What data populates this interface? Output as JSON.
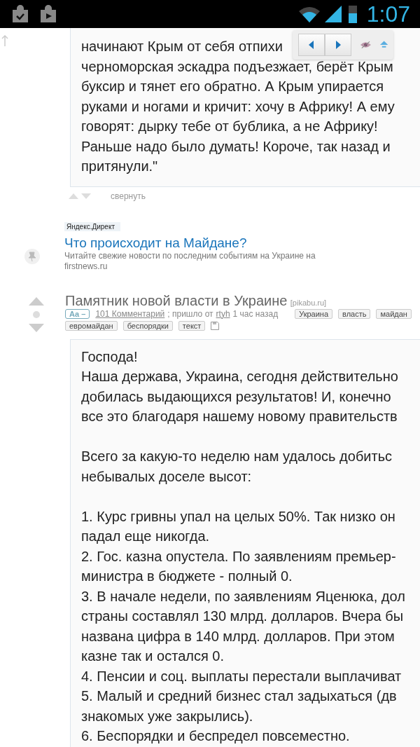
{
  "status_bar": {
    "time": "1:07"
  },
  "comment": {
    "lines": [
      "начинают Крым от себя отпихи",
      "черноморская эскадра подъезжает, берёт Крым",
      "буксир и тянет его обратно. А Крым упирается",
      "руками и ногами и кричит: хочу в Африку! А ему",
      "говорят: дырку тебе от бублика, а не Африку!",
      "Раньше надо было думать! Короче, так назад и",
      "притянули.\""
    ],
    "collapse_label": "свернуть"
  },
  "ad": {
    "label": "Яндекс.Директ",
    "title": "Что происходит на Майдане?",
    "description": "Читайте свежие новости по последним событиям на Украине на",
    "domain": "firstnews.ru"
  },
  "post": {
    "title": "Памятник новой власти в Украине",
    "source": "[pikabu.ru]",
    "font_button": "Аа –",
    "comments_link": "101 Комментарий",
    "posted_by": "; пришло от",
    "author": "rtyh",
    "time": "1 час назад",
    "tags": [
      "Украина",
      "власть",
      "майдан",
      "евромайдан",
      "беспорядки",
      "текст"
    ],
    "body_paragraphs": [
      [
        "Господа!",
        "Наша держава, Украина, сегодня действительно",
        "добилась выдающихся результатов! И, конечно",
        "все это благодаря нашему новому правительств"
      ],
      [
        "Всего за какую-то неделю нам удалось добитьс",
        "небывалых доселе высот:"
      ],
      [
        "1. Курс гривны упал на целых 50%. Так низко он",
        "падал еще никогда.",
        "2. Гос. казна опустела. По заявлениям премьер-",
        "министра в бюджете - полный 0.",
        "3. В начале недели, по заявлениям Яценюка, дол",
        "страны составлял 130 млрд. долларов. Вчера бы",
        "названа цифра в 140 млрд. долларов. При этом",
        "казне так и остался 0.",
        "4. Пенсии и соц. выплаты перестали выплачиват",
        "5. Малый и средний бизнес стал задыхаться (дв",
        "знакомых уже закрылись).",
        "6. Беспорядки и беспредел повсеместно."
      ]
    ]
  }
}
